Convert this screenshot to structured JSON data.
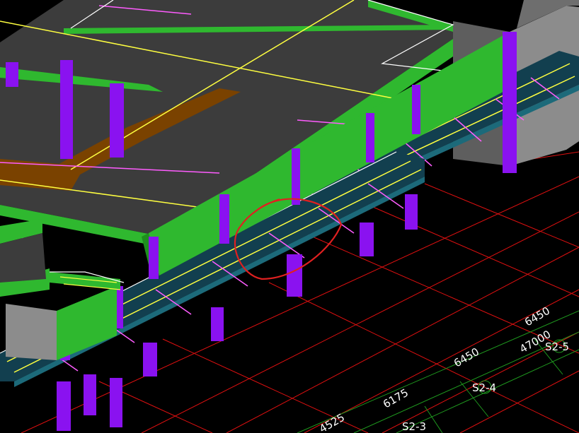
{
  "viewport": {
    "background": "#000000"
  },
  "colors": {
    "slab_top": "#3c3c3c",
    "beam_green": "#2fb82f",
    "beam_green_dark": "#1e8f1e",
    "column_purple": "#8a12f0",
    "column_purple_dark": "#5a0aa8",
    "walkway_teal": "#123f4f",
    "walkway_edge": "#1c6a7a",
    "highlight_slab": "#7a4200",
    "wall_gray": "#8c8c8c",
    "wall_gray_dark": "#5e5e5e",
    "rebar_yellow": "#ffff40",
    "rebar_magenta": "#ff5cff",
    "grid_red": "#e01010",
    "grid_green": "#1f9a1f",
    "outline_white": "#ffffff",
    "markup_red": "#e02020"
  },
  "dimensions": {
    "d1": "6450",
    "d2": "47000",
    "d3": "6450",
    "d4": "6175",
    "d5": "4525"
  },
  "axis_labels": {
    "a1": "S2-5",
    "a2": "S2-4",
    "a3": "S2-3"
  },
  "markup": {
    "type": "freehand-circle",
    "color": "#e02020"
  }
}
